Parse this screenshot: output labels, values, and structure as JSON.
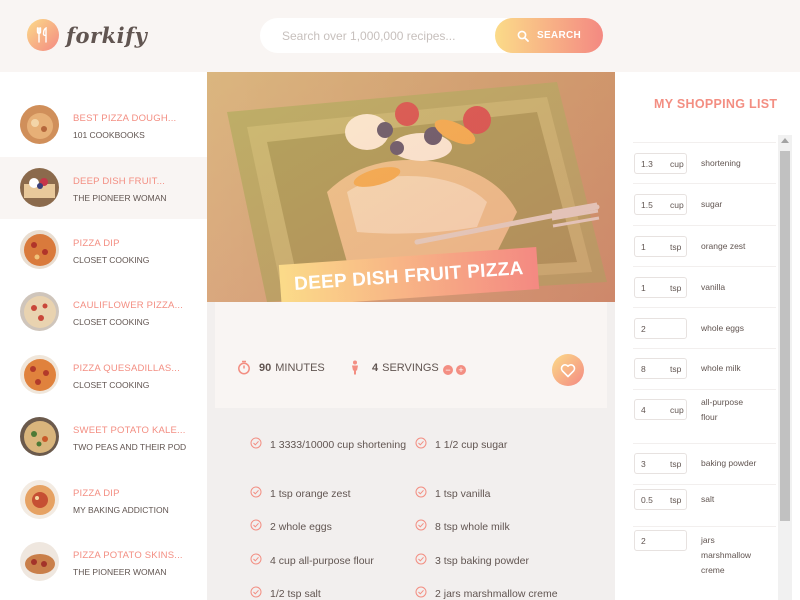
{
  "app": {
    "logo_text": "forkify"
  },
  "search": {
    "placeholder": "Search over 1,000,000 recipes...",
    "button_label": "SEARCH"
  },
  "results": [
    {
      "title": "BEST PIZZA DOUGH...",
      "publisher": "101 COOKBOOKS"
    },
    {
      "title": "DEEP DISH FRUIT...",
      "publisher": "THE PIONEER WOMAN"
    },
    {
      "title": "PIZZA DIP",
      "publisher": "CLOSET COOKING"
    },
    {
      "title": "CAULIFLOWER PIZZA...",
      "publisher": "CLOSET COOKING"
    },
    {
      "title": "PIZZA QUESADILLAS...",
      "publisher": "CLOSET COOKING"
    },
    {
      "title": "SWEET POTATO KALE...",
      "publisher": "TWO PEAS AND THEIR POD"
    },
    {
      "title": "PIZZA DIP",
      "publisher": "MY BAKING ADDICTION"
    },
    {
      "title": "PIZZA POTATO SKINS...",
      "publisher": "THE PIONEER WOMAN"
    }
  ],
  "recipe": {
    "title": "DEEP DISH FRUIT PIZZA",
    "minutes": "90",
    "minutes_label": "MINUTES",
    "servings": "4",
    "servings_label": "SERVINGS",
    "ingredients": [
      "1 3333/10000 cup shortening",
      "1 1/2 cup sugar",
      "1 tsp orange zest",
      "1 tsp vanilla",
      "2 whole eggs",
      "8 tsp whole milk",
      "4 cup all-purpose flour",
      "3 tsp baking powder",
      "1/2 tsp salt",
      "2 jars marshmallow creme"
    ]
  },
  "shopping": {
    "title": "MY SHOPPING LIST",
    "items": [
      {
        "count": "1.3",
        "unit": "cup",
        "name": "shortening"
      },
      {
        "count": "1.5",
        "unit": "cup",
        "name": "sugar"
      },
      {
        "count": "1",
        "unit": "tsp",
        "name": "orange zest"
      },
      {
        "count": "1",
        "unit": "tsp",
        "name": "vanilla"
      },
      {
        "count": "2",
        "unit": "",
        "name": "whole eggs"
      },
      {
        "count": "8",
        "unit": "tsp",
        "name": "whole milk"
      },
      {
        "count": "4",
        "unit": "cup",
        "name": "all-purpose flour"
      },
      {
        "count": "3",
        "unit": "tsp",
        "name": "baking powder"
      },
      {
        "count": "0.5",
        "unit": "tsp",
        "name": "salt"
      },
      {
        "count": "2",
        "unit": "",
        "name": "jars marshmallow creme"
      }
    ]
  },
  "colors": {
    "accent_start": "#fbdb89",
    "accent_end": "#f48982",
    "text": "#615551",
    "accent_text": "#f38e82"
  }
}
